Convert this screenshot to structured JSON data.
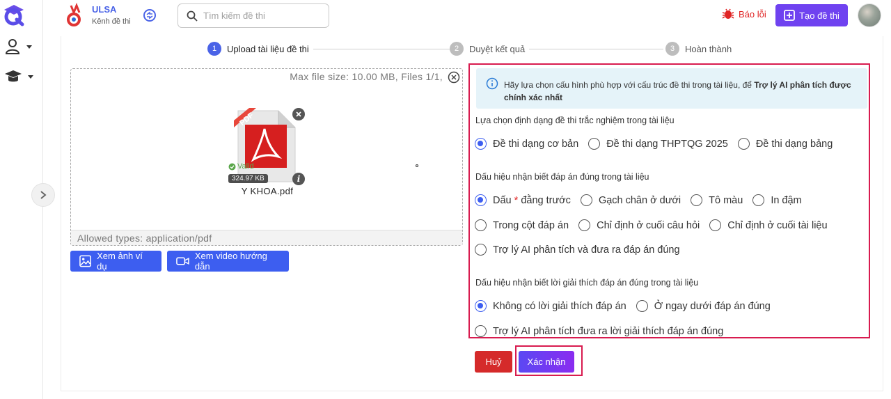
{
  "header": {
    "brand_name": "ULSA",
    "brand_sub": "Kênh đề thi",
    "search_placeholder": "Tìm kiếm đề thi",
    "report_label": "Báo lỗi",
    "create_label": "Tạo đề thi"
  },
  "stepper": {
    "steps": [
      {
        "num": "1",
        "label": "Upload tài liệu đề thi",
        "active": true
      },
      {
        "num": "2",
        "label": "Duyệt kết quả",
        "active": false
      },
      {
        "num": "3",
        "label": "Hoàn thành",
        "active": false
      }
    ]
  },
  "upload": {
    "meta": "Max file size: 10.00 MB, Files 1/1,",
    "allowed": "Allowed types: application/pdf",
    "file": {
      "name": "Y KHOA.pdf",
      "status": "Valid",
      "size": "324.97 KB",
      "type_badge": "PDF"
    }
  },
  "actions": {
    "sample_image": "Xem ảnh ví dụ",
    "guide_video": "Xem video hướng dẫn"
  },
  "config": {
    "info_text": "Hãy lựa chọn cấu hình phù hợp với cấu trúc đề thi trong tài liệu, để ",
    "info_bold": "Trợ lý AI phân tích được chính xác nhất",
    "format_label": "Lựa chọn định dạng đề thi trắc nghiệm trong tài liệu",
    "format_options": [
      "Đề thi dạng cơ bản",
      "Đề thi dạng THPTQG 2025",
      "Đề thi dạng bảng"
    ],
    "format_selected": 0,
    "answer_label": "Dấu hiệu nhận biết đáp án đúng trong tài liệu",
    "answer_options": {
      "o0_prefix": "Dấu ",
      "o0_star": "*",
      "o0_suffix": " đằng trước",
      "o1": "Gạch chân ở dưới",
      "o2": "Tô màu",
      "o3": "In đậm",
      "o4": "Trong cột đáp án",
      "o5": "Chỉ định ở cuối câu hỏi",
      "o6": "Chỉ định ở cuối tài liệu",
      "o7": "Trợ lý AI phân tích và đưa ra đáp án đúng"
    },
    "answer_selected": 0,
    "explain_label": "Dấu hiệu nhận biết lời giải thích đáp án đúng trong tài liệu",
    "explain_options": [
      "Không có lời giải thích đáp án",
      "Ở ngay dưới đáp án đúng",
      "Trợ lý AI phân tích đưa ra lời giải thích đáp án đúng"
    ],
    "explain_selected": 0
  },
  "footer_buttons": {
    "cancel": "Huỷ",
    "confirm": "Xác nhận"
  },
  "colors": {
    "primary": "#3d5ef0",
    "accent": "#6f42f0",
    "danger": "#d52a2a",
    "highlight_border": "#d81b4f"
  }
}
